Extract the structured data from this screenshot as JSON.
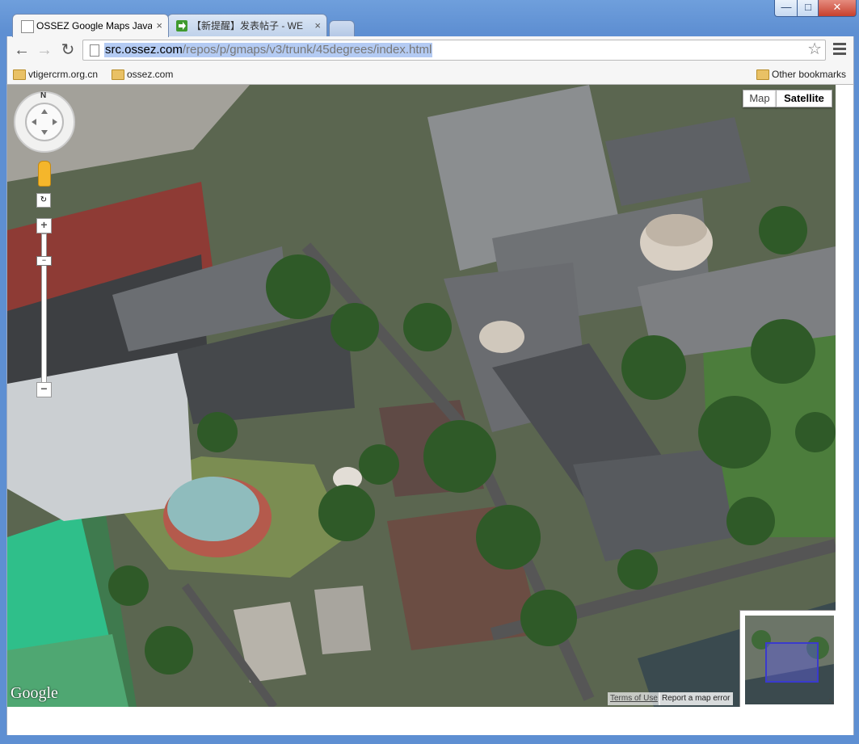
{
  "window": {
    "minimize_label": "—",
    "maximize_label": "□",
    "close_label": "✕"
  },
  "tabs": [
    {
      "title": "OSSEZ Google Maps JavaS",
      "close": "×",
      "active": true
    },
    {
      "title": "【新提醒】发表帖子 - WE",
      "close": "×",
      "active": false
    }
  ],
  "toolbar": {
    "back": "←",
    "forward": "→",
    "reload": "↻",
    "url_host": "src.ossez.com",
    "url_path": "/repos/p/gmaps/v3/trunk/45degrees/index.html",
    "star": "☆"
  },
  "bookmarks": [
    {
      "label": "vtigercrm.org.cn"
    },
    {
      "label": "ossez.com"
    }
  ],
  "other_bookmarks": "Other bookmarks",
  "map": {
    "type_map": "Map",
    "type_satellite": "Satellite",
    "compass_n": "N",
    "zoom_in": "+",
    "zoom_out": "−",
    "logo": "Google",
    "terms": "Terms of Use",
    "report": "Report a map error",
    "overview_toggle": "↘"
  }
}
